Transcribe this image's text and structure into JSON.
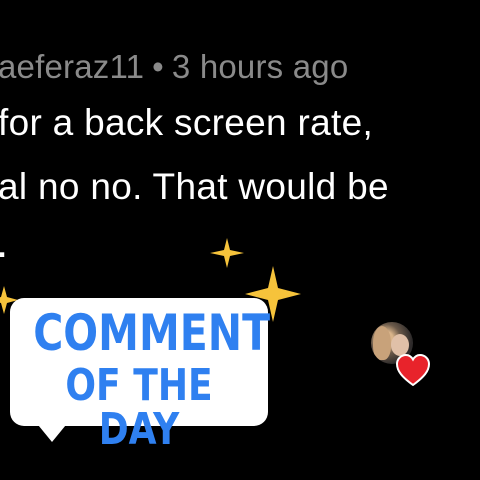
{
  "comment": {
    "username": "aeferaz11",
    "separator": "•",
    "timestamp": "3 hours ago",
    "text_lines": [
      "for a back screen rate,",
      "al no no. That would be",
      "."
    ]
  },
  "badge": {
    "line1": "COMMENT",
    "line2": "OF THE DAY"
  },
  "colors": {
    "background": "#000000",
    "meta_text": "#8a8a8a",
    "comment_text": "#ffffff",
    "badge_text": "#2f80f0",
    "sparkle": "#f6c33b",
    "heart": "#e8232b"
  },
  "icons": [
    "sparkle-icon",
    "avatar",
    "heart-icon"
  ]
}
